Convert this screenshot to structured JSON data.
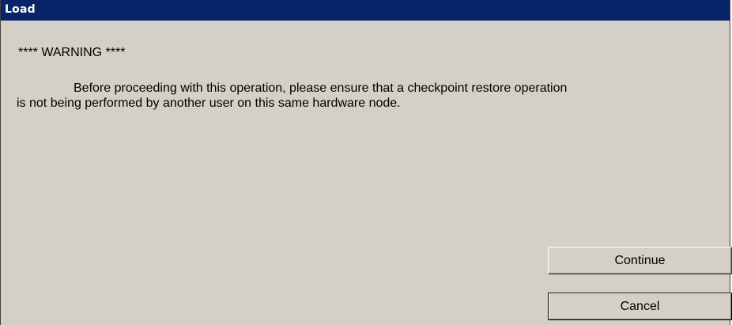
{
  "window": {
    "title": "Load"
  },
  "warning": {
    "heading": "**** WARNING ****",
    "message": "Before proceeding with this operation, please ensure that a checkpoint restore operation is not being performed by another user on this same hardware node."
  },
  "buttons": {
    "continue_label": "Continue",
    "cancel_label": "Cancel"
  },
  "colors": {
    "titlebar": "#0a246a",
    "dialog_background": "#d4d0c8",
    "title_text": "#ffffff"
  }
}
